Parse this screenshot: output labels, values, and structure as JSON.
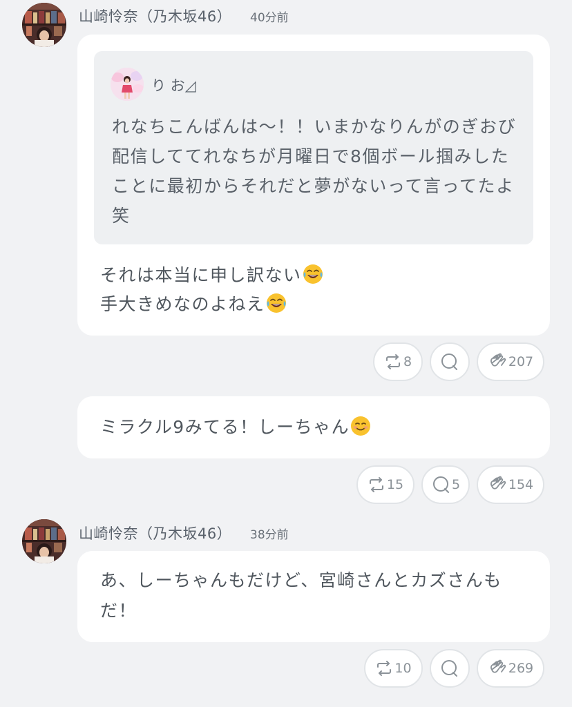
{
  "posts": [
    {
      "author": "山崎怜奈（乃木坂46）",
      "time": "40分前",
      "quote": {
        "author": "り お◿",
        "text": "れなちこんばんは〜！！いまかなりんがのぎおび配信しててれなちが月曜日で8個ボール掴みしたことに最初からそれだと夢がないって言ってたよ笑"
      },
      "reply_lines": [
        "それは本当に申し訳ない",
        "手大きめなのよねえ"
      ],
      "reply_emojis": [
        "face-with-tears-of-joy",
        "face-with-tears-of-joy"
      ],
      "repost_count": "8",
      "comment_count": "",
      "clap_count": "207"
    },
    {
      "text": "ミラクル9みてる！しーちゃん",
      "emoji": "smiling-face",
      "repost_count": "15",
      "comment_count": "5",
      "clap_count": "154"
    },
    {
      "author": "山崎怜奈（乃木坂46）",
      "time": "38分前",
      "text_lines": [
        "あ、しーちゃんもだけど、宮崎さんとカズさんも",
        "だ！"
      ],
      "repost_count": "10",
      "comment_count": "",
      "clap_count": "269"
    }
  ],
  "icons": {
    "repost": "repost-icon",
    "comment": "comment-icon",
    "clap": "clap-icon"
  },
  "colors": {
    "background": "#f1f2f4",
    "bubble": "#ffffff",
    "quote_background": "#eef0f2",
    "text": "#4f565d",
    "muted": "#8b9298"
  }
}
